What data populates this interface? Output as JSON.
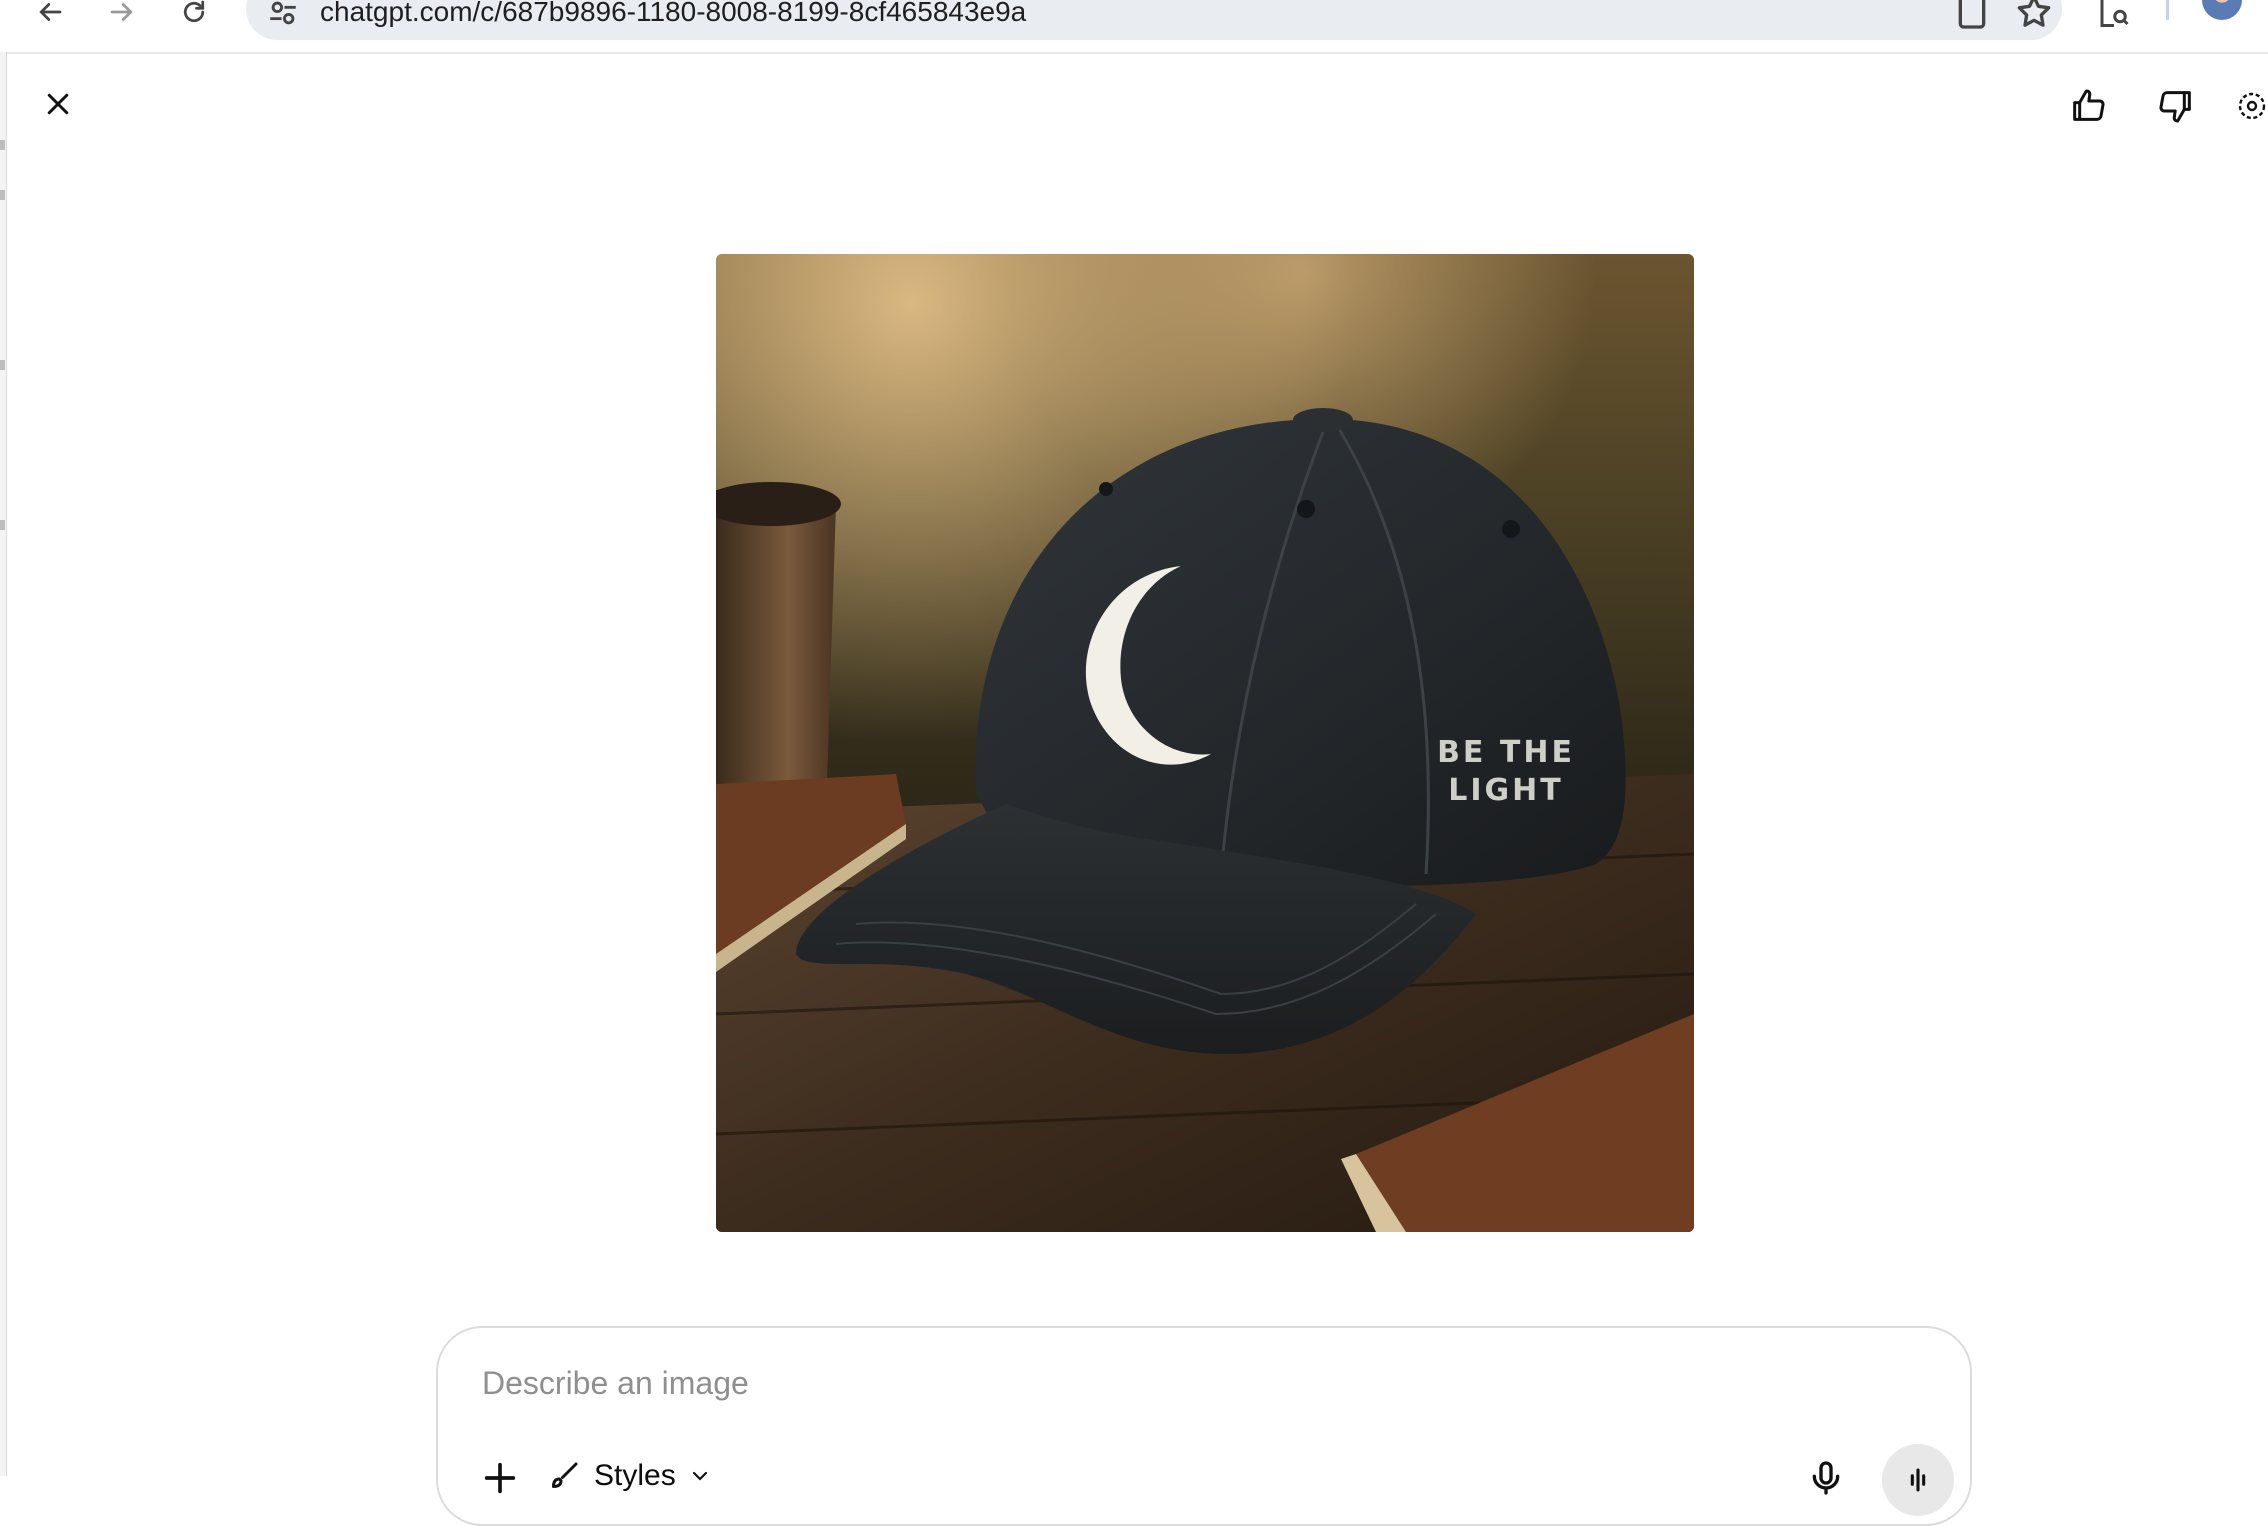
{
  "browser": {
    "url": "chatgpt.com/c/687b9896-1180-8008-8199-8cf465843e9a",
    "icons": [
      "back-icon",
      "forward-icon",
      "reload-icon",
      "site-settings-icon",
      "install-app-icon",
      "bookmark-star-icon",
      "lens-icon"
    ]
  },
  "viewer": {
    "close_icon": "close-icon",
    "actions": [
      "thumbs-up-icon",
      "thumbs-down-icon",
      "select-area-icon"
    ],
    "image": {
      "embroidered_text_line1": "BE THE",
      "embroidered_text_line2": "LIGHT"
    }
  },
  "composer": {
    "placeholder": "Describe an image",
    "styles_label": "Styles",
    "icons": [
      "plus-icon",
      "brush-icon",
      "chevron-down-icon",
      "microphone-icon",
      "voice-icon"
    ]
  },
  "colors": {
    "accent_gray": "#e8e8e8",
    "url_bar_bg": "#e9ecf1",
    "cap": "#23272a"
  }
}
